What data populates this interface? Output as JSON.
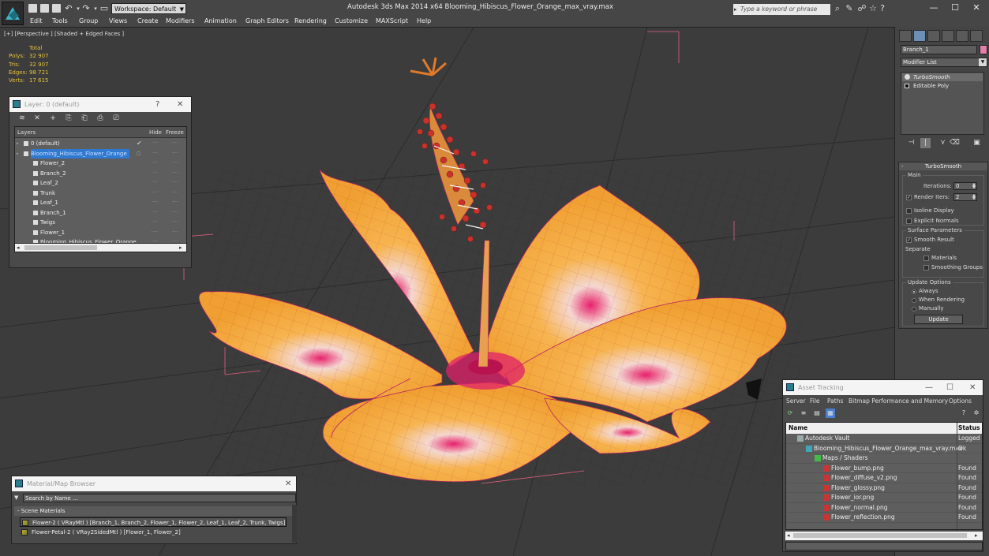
{
  "window": {
    "title": "Autodesk 3ds Max  2014 x64     Blooming_Hibiscus_Flower_Orange_max_vray.max",
    "workspace": "Workspace: Default",
    "search_placeholder": "Type a keyword or phrase",
    "minimize": "—",
    "maximize": "☐",
    "close": "✕"
  },
  "menu": [
    "Edit",
    "Tools",
    "Group",
    "Views",
    "Create",
    "Modifiers",
    "Animation",
    "Graph Editors",
    "Rendering",
    "Customize",
    "MAXScript",
    "Help"
  ],
  "viewport": {
    "label": "[+] [Perspective ] [Shaded + Edged Faces ]",
    "stats": {
      "header": "Total",
      "rows": [
        {
          "key": "Polys:",
          "value": "32 907"
        },
        {
          "key": "Tris:",
          "value": "32 907"
        },
        {
          "key": "Edges:",
          "value": "98 721"
        },
        {
          "key": "Verts:",
          "value": "17 615"
        }
      ]
    },
    "colors": {
      "petal": "#f2a83c",
      "wire": "#b8245f",
      "center": "#e0206a",
      "anther": "#c8322a",
      "background": "#3c3c3c"
    }
  },
  "command_panel": {
    "object_name": "Branch_1",
    "object_color": "#e37fa8",
    "modifier_list": "Modifier List",
    "stack": [
      "TurboSmooth",
      "Editable Poly"
    ],
    "rollout_title": "TurboSmooth",
    "main": {
      "title": "Main",
      "iterations_label": "Iterations:",
      "iterations_value": "0",
      "render_iters_label": "Render Iters:",
      "render_iters_value": "2",
      "render_iters_checked": true,
      "isoline_label": "Isoline Display",
      "explicit_label": "Explicit Normals"
    },
    "surface": {
      "title": "Surface Parameters",
      "smooth_result": "Smooth Result",
      "separate": "Separate",
      "materials": "Materials",
      "smoothing_groups": "Smoothing Groups"
    },
    "update": {
      "title": "Update Options",
      "always": "Always",
      "when_rendering": "When Rendering",
      "manually": "Manually",
      "button": "Update"
    }
  },
  "layer_dialog": {
    "title": "Layer: 0 (default)",
    "help": "?",
    "close": "✕",
    "col_layers": "Layers",
    "col_hide": "Hide",
    "col_freeze": "Freeze",
    "rows": [
      {
        "name": "0 (default)",
        "level": 0,
        "checked": true
      },
      {
        "name": "Blooming_Hibiscus_Flower_Orange",
        "level": 0,
        "selected": true
      },
      {
        "name": "Flower_2",
        "level": 1
      },
      {
        "name": "Branch_2",
        "level": 1
      },
      {
        "name": "Leaf_2",
        "level": 1
      },
      {
        "name": "Trunk",
        "level": 1
      },
      {
        "name": "Leaf_1",
        "level": 1
      },
      {
        "name": "Branch_1",
        "level": 1
      },
      {
        "name": "Twigs",
        "level": 1
      },
      {
        "name": "Flower_1",
        "level": 1
      },
      {
        "name": "Blooming_Hibiscus_Flower_Orange",
        "level": 1
      }
    ]
  },
  "material_browser": {
    "title": "Material/Map Browser",
    "close": "✕",
    "search_placeholder": "Search by Name ...",
    "section": "- Scene Materials",
    "items": [
      "Flower-2  ( VRayMtl )  [Branch_1, Branch_2, Flower_1, Flower_2, Leaf_1, Leaf_2, Trunk, Twigs]",
      "Flower-Petal-2  ( VRay2SidedMtl )  [Flower_1, Flower_2]"
    ]
  },
  "asset_tracking": {
    "title": "Asset Tracking",
    "menu": [
      "Server",
      "File",
      "Paths",
      "Bitmap Performance and Memory",
      "Options"
    ],
    "col_name": "Name",
    "col_status": "Status",
    "rows": [
      {
        "name": "Autodesk Vault",
        "status": "Logged O",
        "level": 0,
        "icon": "vault-icon"
      },
      {
        "name": "Blooming_Hibiscus_Flower_Orange_max_vray.max",
        "status": "Ok",
        "level": 1,
        "icon": "max-file-icon"
      },
      {
        "name": "Maps / Shaders",
        "status": "",
        "level": 2,
        "icon": "maps-icon"
      },
      {
        "name": "Flower_bump.png",
        "status": "Found",
        "level": 3,
        "icon": "png-icon"
      },
      {
        "name": "Flower_diffuse_v2.png",
        "status": "Found",
        "level": 3,
        "icon": "png-icon"
      },
      {
        "name": "Flower_glossy.png",
        "status": "Found",
        "level": 3,
        "icon": "png-icon"
      },
      {
        "name": "Flower_ior.png",
        "status": "Found",
        "level": 3,
        "icon": "png-icon"
      },
      {
        "name": "Flower_normal.png",
        "status": "Found",
        "level": 3,
        "icon": "png-icon"
      },
      {
        "name": "Flower_reflection.png",
        "status": "Found",
        "level": 3,
        "icon": "png-icon"
      }
    ]
  }
}
